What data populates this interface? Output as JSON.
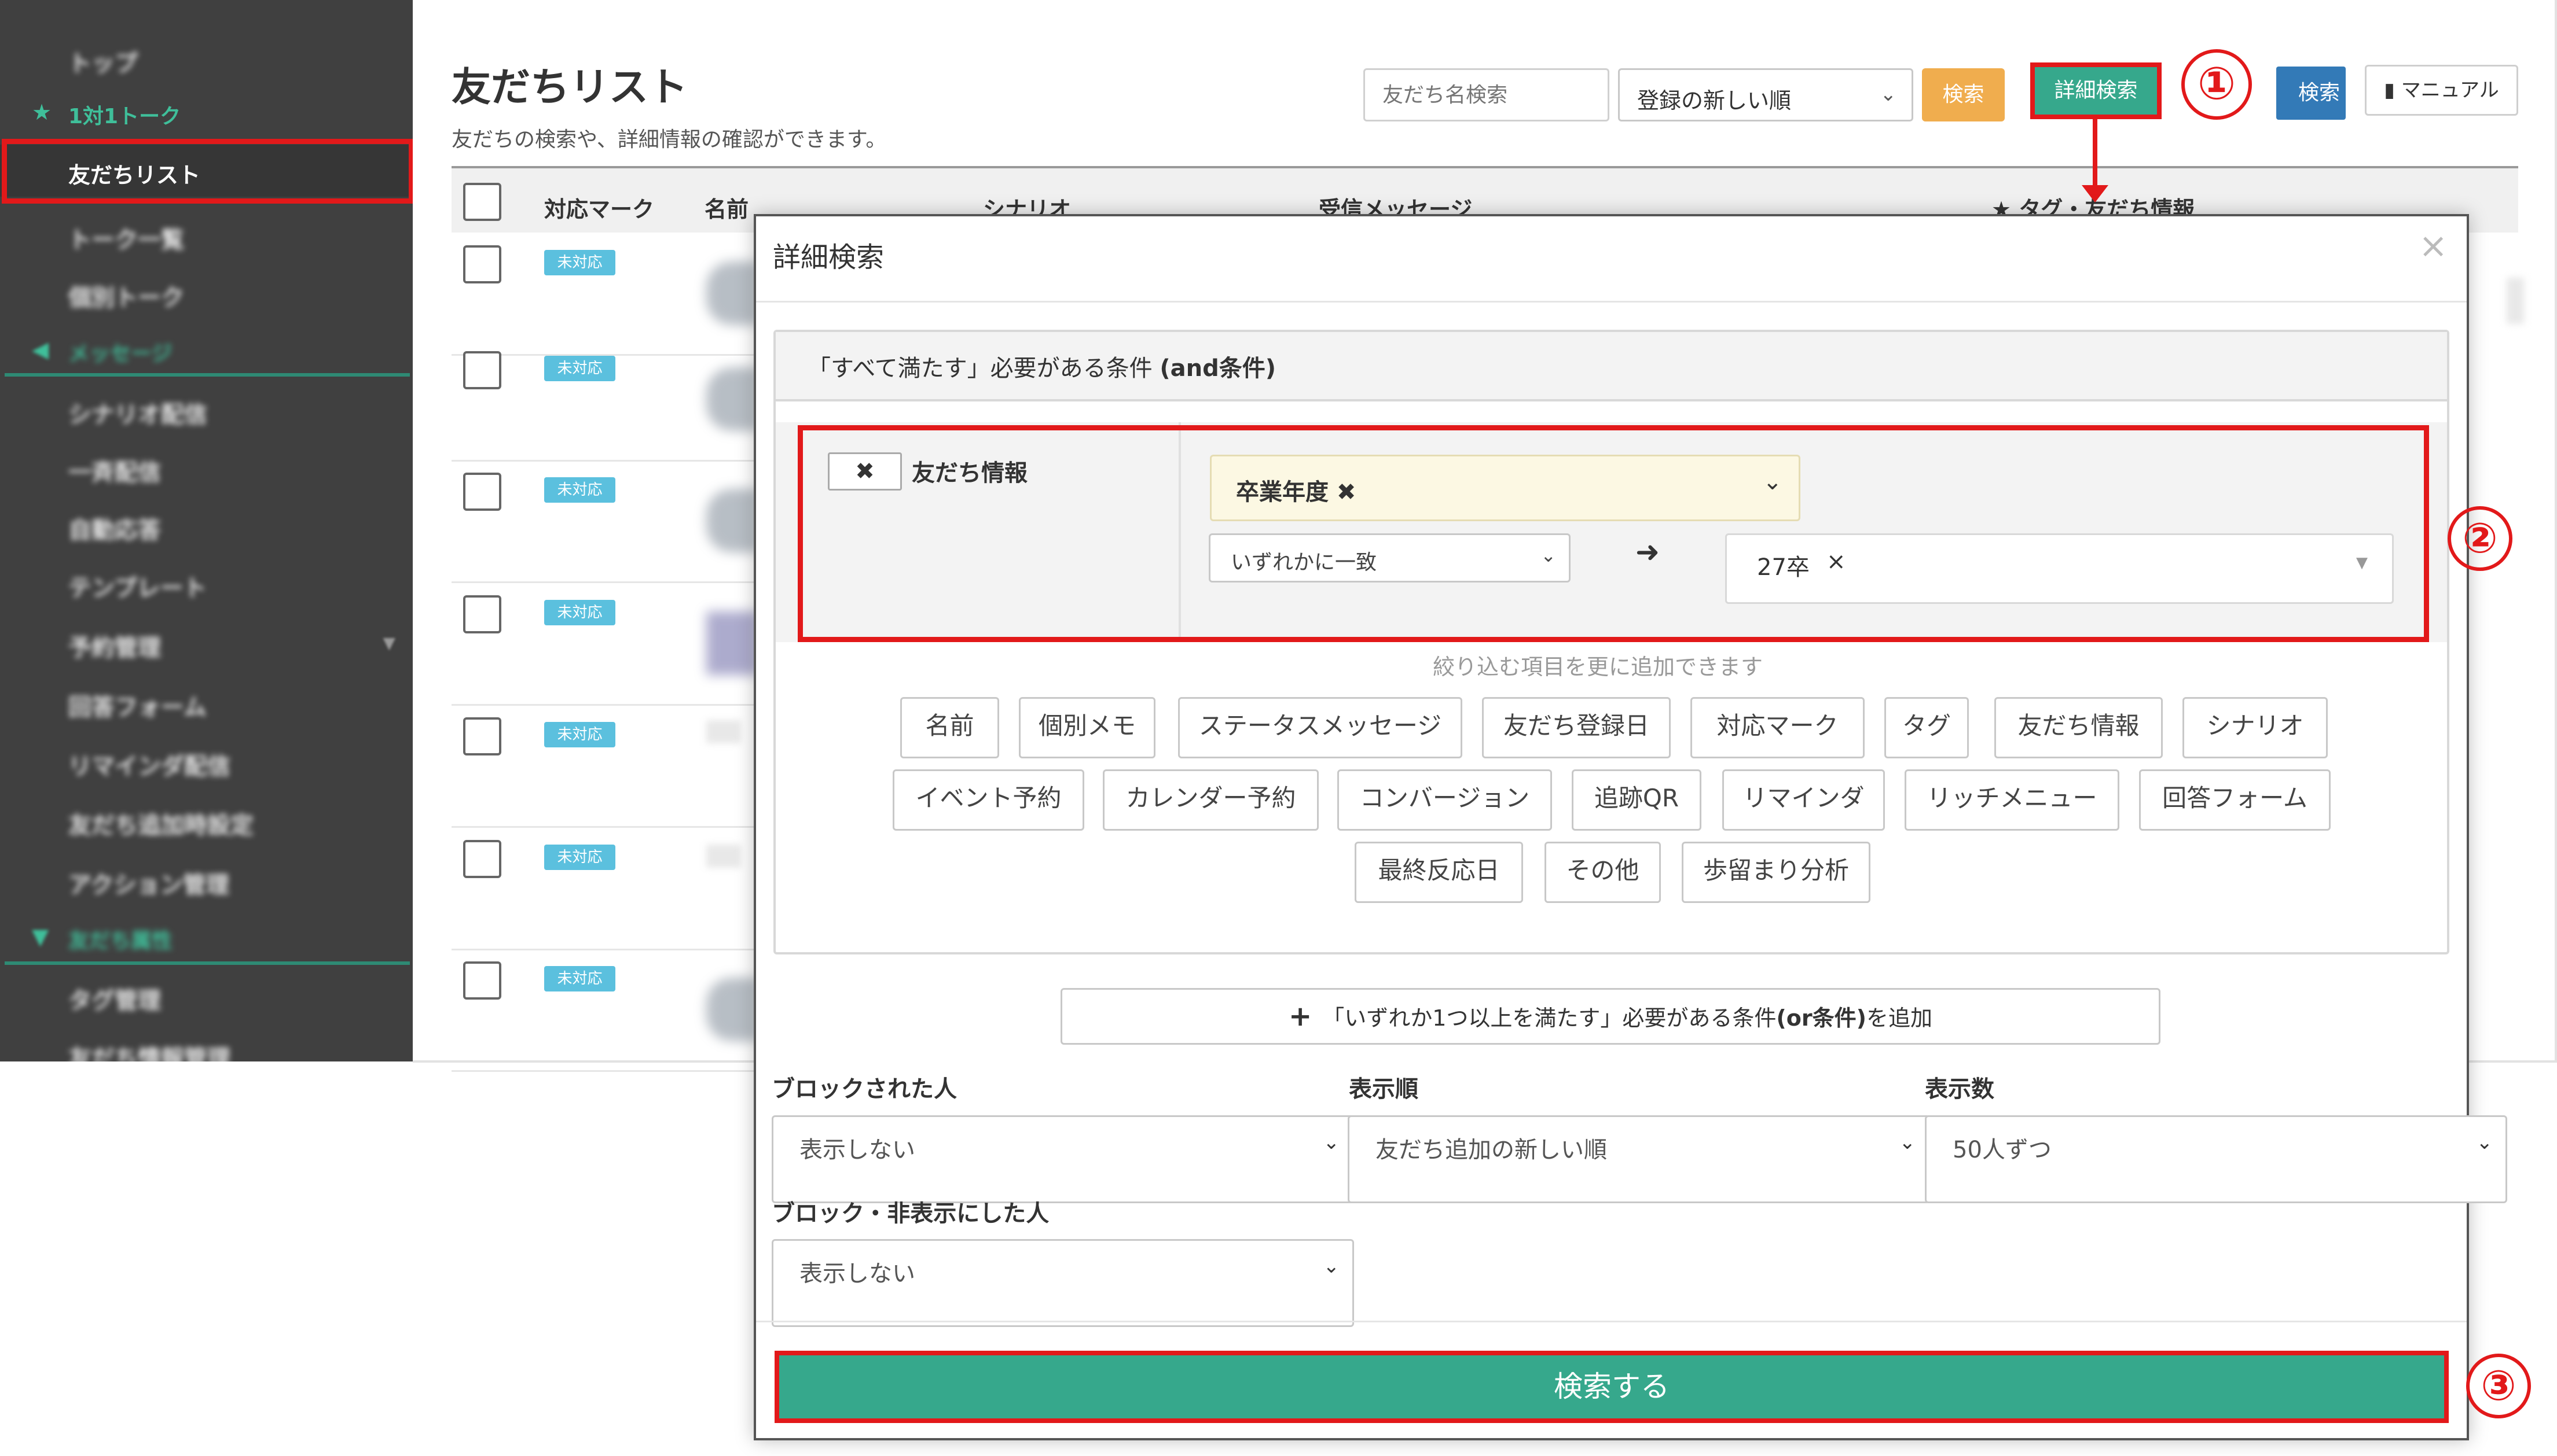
{
  "sidebar": {
    "items": [
      {
        "label": "トップ"
      },
      {
        "label": "1対1トーク",
        "icon": "star-icon"
      },
      {
        "label": "友だちリスト"
      },
      {
        "label": "トーク一覧"
      },
      {
        "label": "個別トーク"
      },
      {
        "label": "メッセージ",
        "icon": "megaphone-icon"
      },
      {
        "label": "シナリオ配信"
      },
      {
        "label": "一斉配信"
      },
      {
        "label": "自動応答"
      },
      {
        "label": "テンプレート"
      },
      {
        "label": "予約管理"
      },
      {
        "label": "回答フォーム"
      },
      {
        "label": "リマインダ配信"
      },
      {
        "label": "友だち追加時設定"
      },
      {
        "label": "アクション管理"
      },
      {
        "label": "友だち属性",
        "icon": "filter-icon"
      },
      {
        "label": "タグ管理"
      },
      {
        "label": "友だち情報管理"
      }
    ]
  },
  "header": {
    "title": "友だちリスト",
    "subtitle": "友だちの検索や、詳細情報の確認ができます。",
    "search_placeholder": "友だち名検索",
    "sort_value": "登録の新しい順",
    "search_label": "検索",
    "detail_search_label": "詳細検索",
    "other_search_label": "検索",
    "manual_label": "マニュアル"
  },
  "table": {
    "columns": [
      "対応マーク",
      "名前",
      "シナリオ",
      "受信メッセージ",
      "★ タグ・友だち情報"
    ],
    "rows": [
      {
        "status": "未対応"
      },
      {
        "status": "未対応"
      },
      {
        "status": "未対応"
      },
      {
        "status": "未対応"
      },
      {
        "status": "未対応"
      },
      {
        "status": "未対応"
      },
      {
        "status": "未対応"
      }
    ]
  },
  "modal": {
    "title": "詳細検索",
    "close": "×",
    "and_panel_title_prefix": "「すべて満たす」必要がある条件 ",
    "and_panel_title_bold": "(and条件)",
    "condition": {
      "remove": "✖",
      "type_label": "友だち情報",
      "field": "卒業年度 ✖",
      "match": "いずれかに一致",
      "value": "27卒",
      "value_remove": "×"
    },
    "add_hint": "絞り込む項目を更に追加できます",
    "filter_buttons": [
      "名前",
      "個別メモ",
      "ステータスメッセージ",
      "友だち登録日",
      "対応マーク",
      "タグ",
      "友だち情報",
      "シナリオ",
      "イベント予約",
      "カレンダー予約",
      "コンバージョン",
      "追跡QR",
      "リマインダ",
      "リッチメニュー",
      "回答フォーム",
      "最終反応日",
      "その他",
      "歩留まり分析"
    ],
    "add_or_prefix": "「いずれか1つ以上を満たす」必要がある条件",
    "add_or_bold": "(or条件)",
    "add_or_suffix": "を追加",
    "blocked_label": "ブロックされた人",
    "blocked_value": "表示しない",
    "order_label": "表示順",
    "order_value": "友だち追加の新しい順",
    "count_label": "表示数",
    "count_value": "50人ずつ",
    "hidden_label": "ブロック・非表示にした人",
    "hidden_value": "表示しない",
    "submit_label": "検索する"
  },
  "annotations": {
    "step1": "①",
    "step2": "②",
    "step3": "③"
  },
  "colors": {
    "accent": "#36a88c",
    "highlight": "#e2191a",
    "warning": "#f0ad4e",
    "info": "#5bc0de",
    "primary": "#337ab7"
  }
}
